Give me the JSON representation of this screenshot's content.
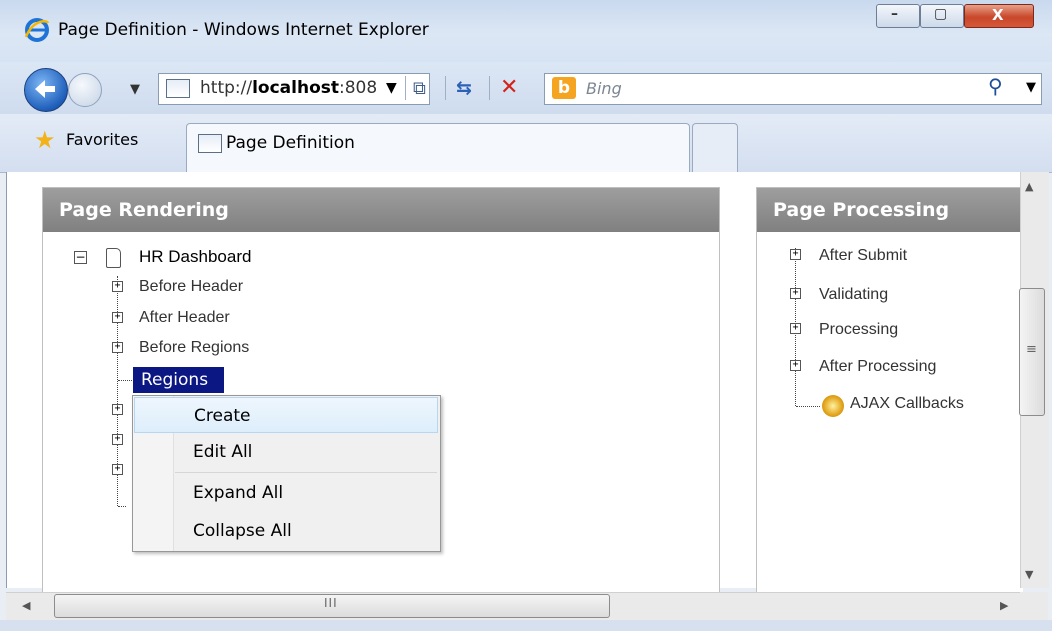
{
  "window": {
    "title": "Page Definition - Windows Internet Explorer",
    "min_glyph": "–",
    "max_glyph": "▢",
    "close_glyph": "X"
  },
  "nav": {
    "address_prefix": "http://",
    "address_host": "localhost",
    "address_rest": ":808",
    "search_placeholder": "Bing",
    "bing_letter": "b"
  },
  "tabs": {
    "favorites_label": "Favorites",
    "active_tab_label": "Page Definition"
  },
  "page_rendering": {
    "header": "Page Rendering",
    "root_label": "HR Dashboard",
    "root_toggle": "−",
    "items": [
      {
        "label": "Before Header"
      },
      {
        "label": "After Header"
      },
      {
        "label": "Before Regions"
      }
    ],
    "selected_item": "Regions",
    "context_menu": [
      "Create",
      "Edit All",
      "Expand All",
      "Collapse All"
    ]
  },
  "page_processing": {
    "header": "Page Processing",
    "items": [
      {
        "label": "After Submit"
      },
      {
        "label": "Validating"
      },
      {
        "label": "Processing"
      },
      {
        "label": "After Processing"
      }
    ],
    "ajax_label": "AJAX Callbacks"
  },
  "scrollbar": {
    "h_grip": "III",
    "v_grip": "≡"
  },
  "colors": {
    "panel_header": "#8f8f8f",
    "selection": "#0b1783",
    "menu_hover": "#ddeefb"
  }
}
